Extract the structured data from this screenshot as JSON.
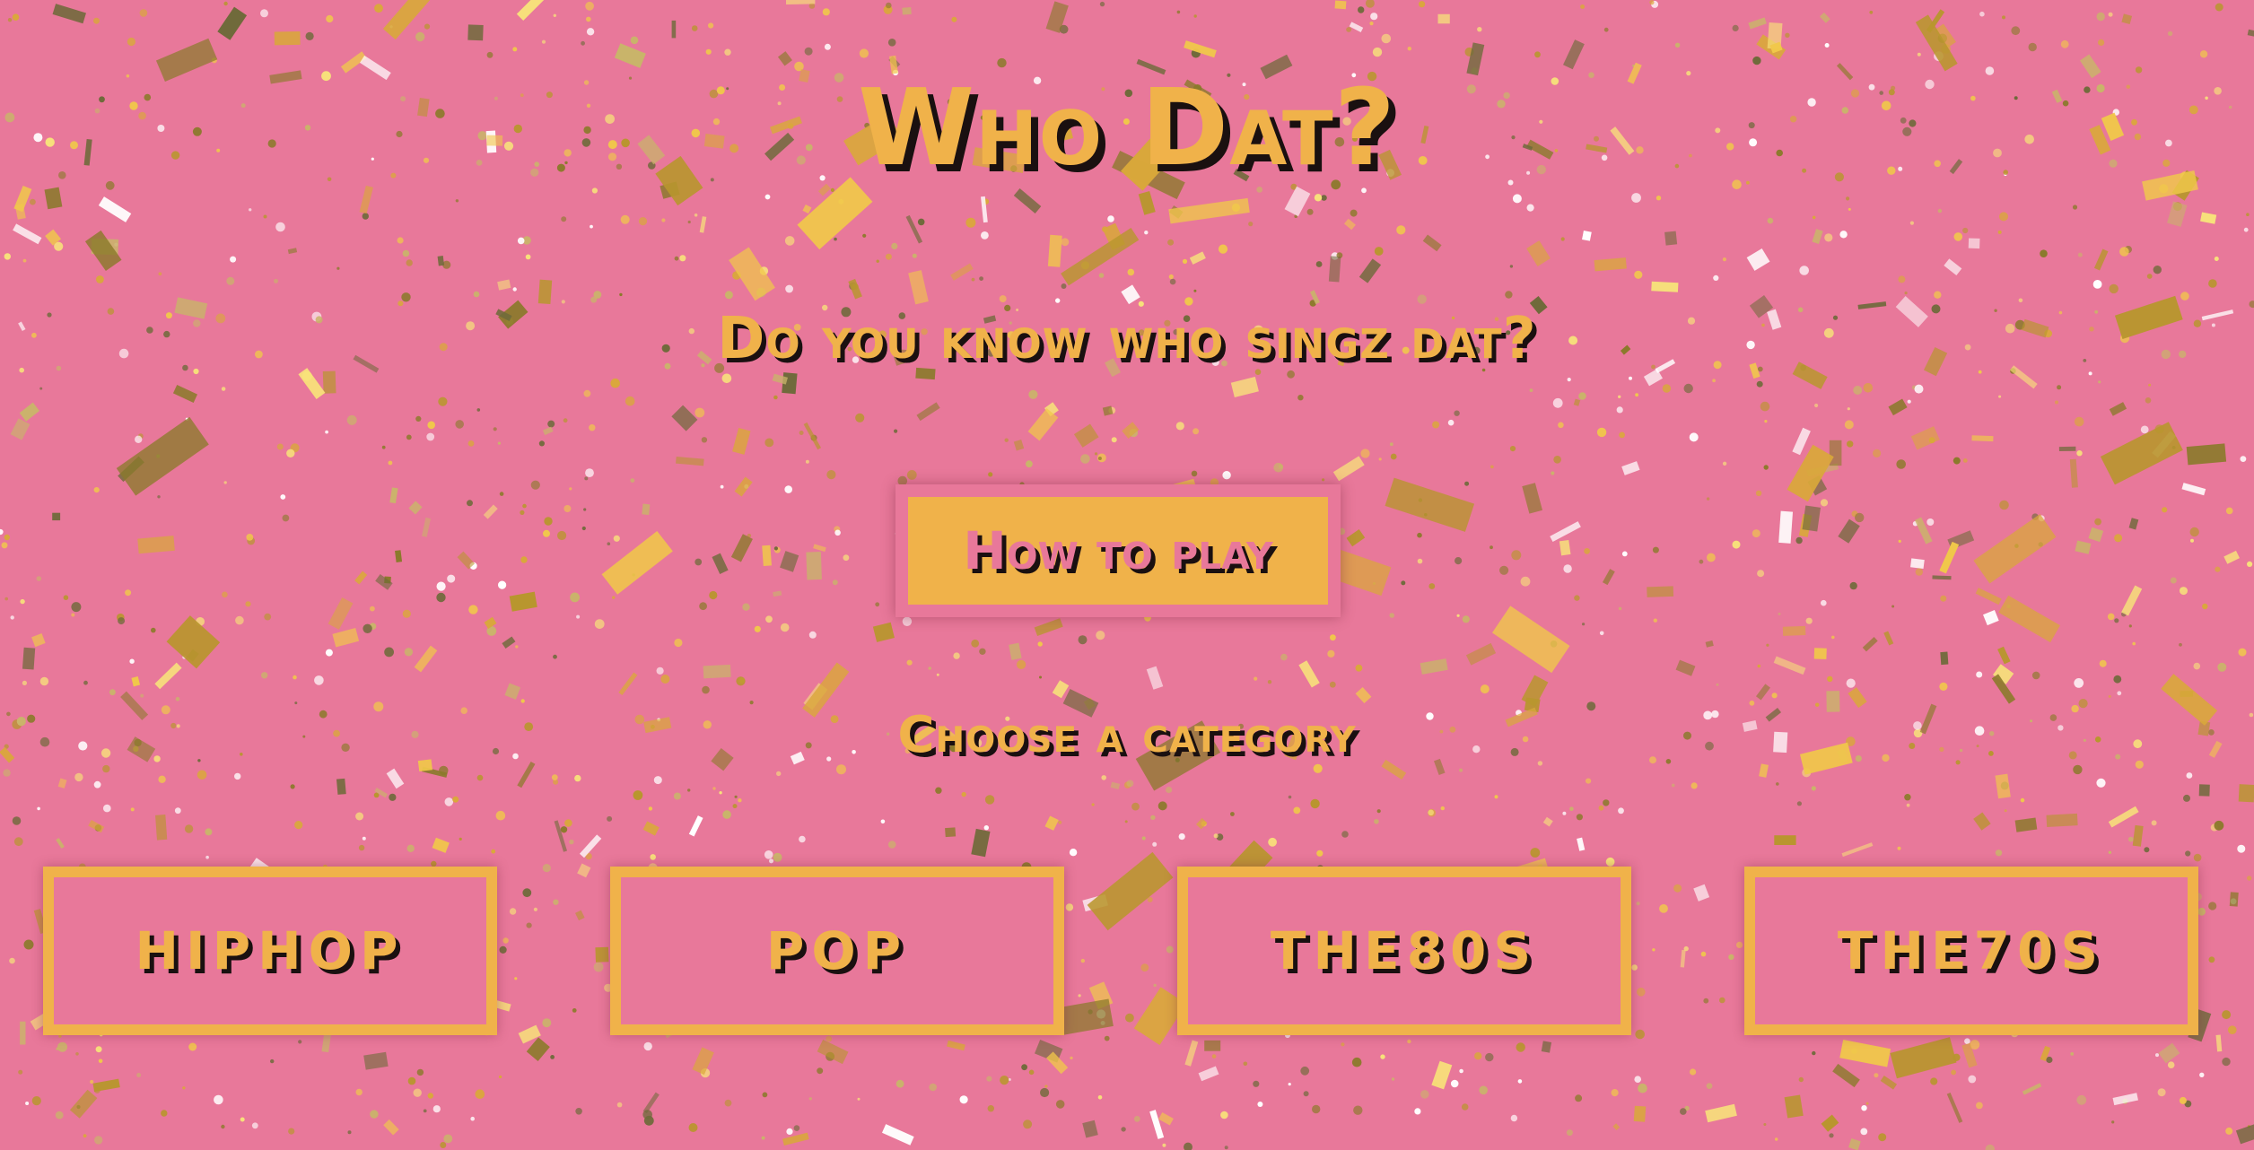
{
  "game": {
    "title": "Who Dat?",
    "tagline": "Do you know who singz dat?",
    "how_to_play_label": "How to play",
    "choose_category_label": "Choose a category",
    "categories": [
      {
        "label": "hiphop"
      },
      {
        "label": "pop"
      },
      {
        "label": "the80s"
      },
      {
        "label": "the70s"
      }
    ]
  },
  "theme": {
    "background": "#e8789a",
    "accent": "#f0b24a",
    "shadow": "#1a1010",
    "confetti_colors": [
      "#f0c84a",
      "#d9a83a",
      "#b8962e",
      "#8a7a2a",
      "#f7e27a",
      "#ffffff",
      "#c9b46a",
      "#6e6a3a"
    ]
  }
}
